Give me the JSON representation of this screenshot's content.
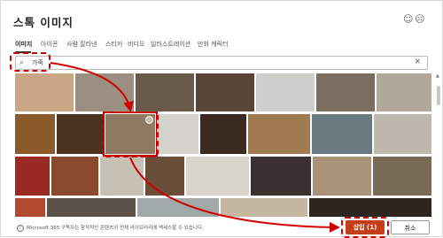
{
  "dialog": {
    "title": "스톡 이미지",
    "emoji_smile": "☺",
    "emoji_frown": "☹"
  },
  "tabs": [
    {
      "label": "이미지",
      "active": true
    },
    {
      "label": "아이콘"
    },
    {
      "label": "사람 잘라낸"
    },
    {
      "label": "스티커"
    },
    {
      "label": "비디오"
    },
    {
      "label": "일러스트레이션"
    },
    {
      "label": "만화 캐릭터"
    }
  ],
  "search": {
    "value": "가죽",
    "icon": "search-icon",
    "clear": "×"
  },
  "images": {
    "selected_index": 5,
    "tile_colors": [
      "#c9a684",
      "#9a8f80",
      "#6a5a4a",
      "#5a4638",
      "#cfd0cb",
      "#7a6e60",
      "#b0a89a",
      "#8a5a2a",
      "#4a3220",
      "#8e7a63",
      "#d4d2cc",
      "#3a2a22",
      "#a07a50",
      "#6b7a80",
      "#bfb8ae",
      "#9a2a22",
      "#8a4a30",
      "#c7c0b4",
      "#6a4e3a",
      "#d8d4cc",
      "#3a3030",
      "#a89278",
      "#7a6a58",
      "#b24a30",
      "#5a5048",
      "#a0a8a8",
      "#c6b8a0",
      "#2c2520"
    ]
  },
  "footer": {
    "note": "Microsoft 365 구독자는 참작적인 콘텐츠의 전체 라이브러리에 액세스할 수 있습니다.",
    "info_icon": "i",
    "insert_label": "삽입 (1)",
    "cancel_label": "취소",
    "accent": "#c43e1c",
    "highlight": "#d00000"
  }
}
